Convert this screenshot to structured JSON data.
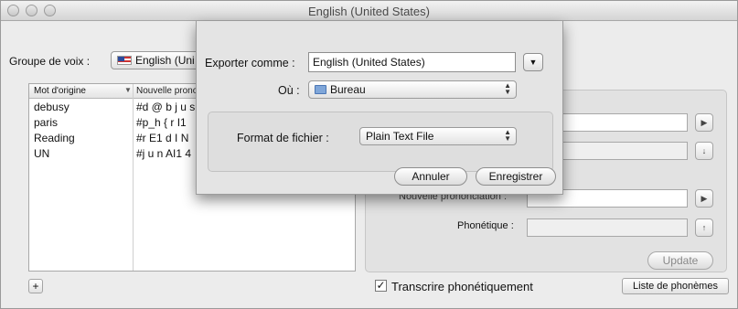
{
  "window": {
    "title": "English (United States)"
  },
  "main": {
    "voice_group_label": "Groupe de voix :",
    "voice_group_value": "English (Uni",
    "list": {
      "col1": "Mot d'origine",
      "col2": "Nouvelle prononciation",
      "rows": [
        {
          "word": "debusy",
          "pron": "#d @ b j u s"
        },
        {
          "word": "paris",
          "pron": "#p_h { r I1"
        },
        {
          "word": "Reading",
          "pron": "#r E1 d I N"
        },
        {
          "word": "UN",
          "pron": "#j u n AI1 4"
        }
      ]
    },
    "add_button": "+",
    "right": {
      "new_pron_label": "Nouvelle prononciation :",
      "phonetic_label": "Phonétique :",
      "update_button": "Update"
    },
    "transcribe_label": "Transcrire phonétiquement",
    "transcribe_checked": true,
    "phonemes_button": "Liste de phonèmes"
  },
  "sheet": {
    "export_label": "Exporter comme :",
    "export_value": "English (United States)",
    "where_label": "Où :",
    "where_value": "Bureau",
    "format_label": "Format de fichier :",
    "format_value": "Plain Text File",
    "cancel_button": "Annuler",
    "save_button": "Enregistrer"
  },
  "icons": {
    "play": "play-icon",
    "arrow_down": "arrow-down-icon",
    "arrow_up": "arrow-up-icon",
    "folder": "folder-icon",
    "flag": "us-flag-icon"
  }
}
